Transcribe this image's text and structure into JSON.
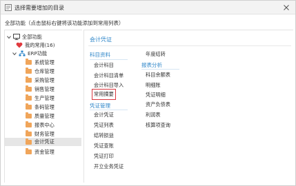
{
  "window": {
    "title": "选择需要增加的目录"
  },
  "instruction": "全部功能（点击鼠标右键将该功能添加到常用列表）",
  "tree": {
    "root": "全部功能",
    "favorites": "我的常用(16)",
    "erp": "ERP功能",
    "modules": [
      "系统管理",
      "仓库管理",
      "采购管理",
      "销售管理",
      "生产管理",
      "条码管理",
      "质量管理",
      "报表中心",
      "财务管理",
      "会计凭证",
      "资金管理"
    ],
    "selected": "会计凭证"
  },
  "content": {
    "title": "会计凭证",
    "groups": {
      "subject_data": {
        "title": "科目资料",
        "items": [
          "会计科目",
          "会计科目清单",
          "会计科目导入",
          "常用摘要"
        ]
      },
      "voucher_mgmt": {
        "title": "凭证管理",
        "items": [
          "会计凭证",
          "凭证列表",
          "结转损益",
          "凭证查账",
          "凭证打印",
          "开立业务凭证"
        ]
      },
      "year_end": {
        "items": [
          "年度结转"
        ]
      },
      "report_analysis": {
        "title": "报表分析",
        "items": [
          "科目余额表",
          "明细账",
          "凭证明细",
          "资产负债表",
          "利润表",
          "核算项查询"
        ]
      }
    },
    "highlighted_item": "常用摘要"
  },
  "colors": {
    "accent": "#2e86c9",
    "folder": "#f0a55a",
    "highlight_border": "#d9363e",
    "favorite": "#e0393e"
  }
}
